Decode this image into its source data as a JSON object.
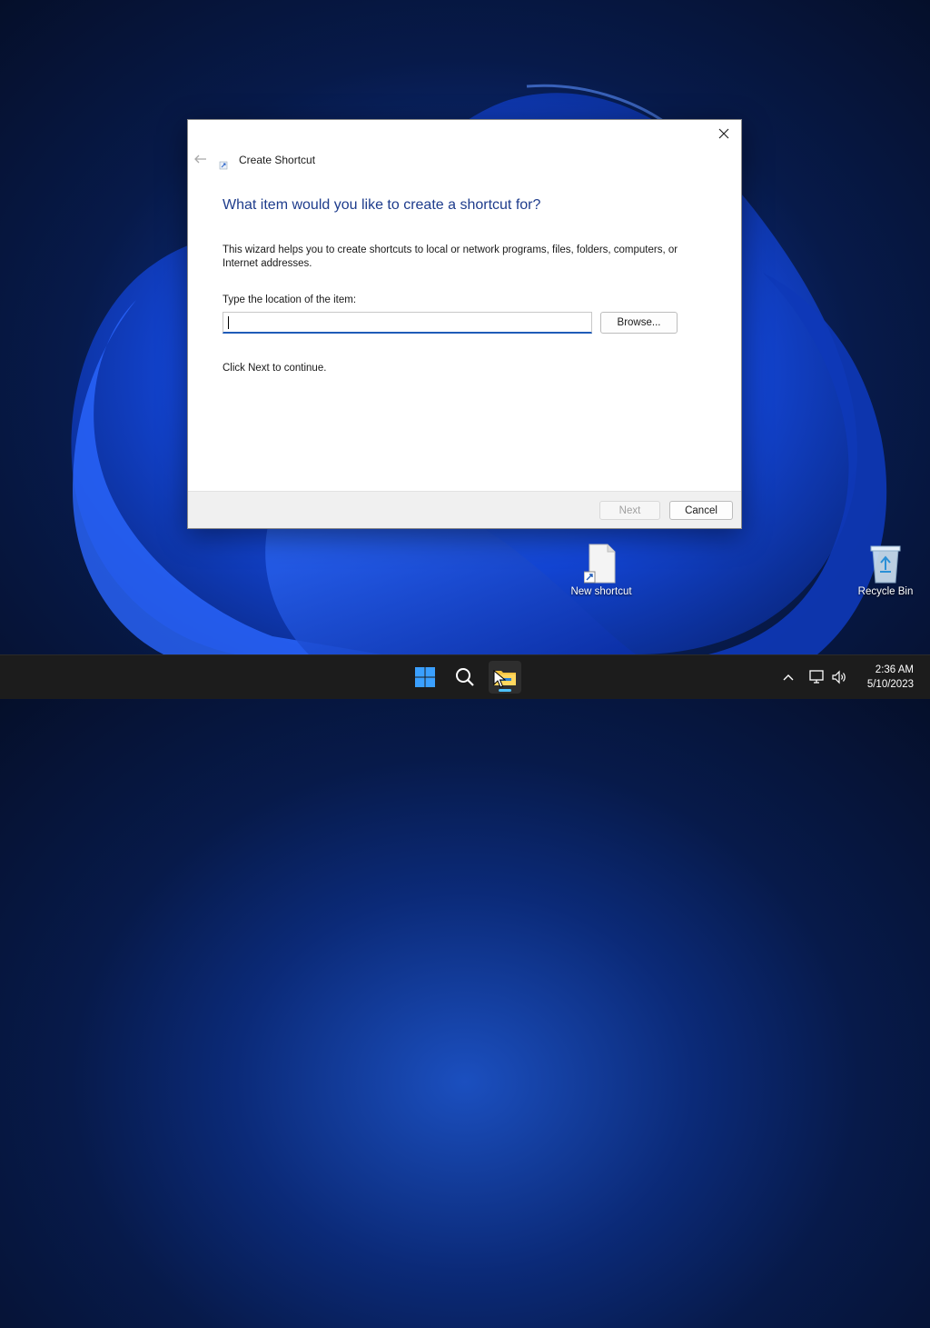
{
  "dialog": {
    "title": "Create Shortcut",
    "heading": "What item would you like to create a shortcut for?",
    "description": "This wizard helps you to create shortcuts to local or network programs, files, folders, computers, or Internet addresses.",
    "location_label": "Type the location of the item:",
    "location_value": "",
    "browse_label": "Browse...",
    "continue_text": "Click Next to continue.",
    "next_label": "Next",
    "cancel_label": "Cancel"
  },
  "desktop": {
    "icons": [
      {
        "label": "New shortcut",
        "icon": "shortcut-file-icon"
      },
      {
        "label": "Recycle Bin",
        "icon": "recycle-bin-icon"
      }
    ]
  },
  "taskbar": {
    "apps": [
      {
        "icon": "windows-start-icon"
      },
      {
        "icon": "search-icon"
      },
      {
        "icon": "file-explorer-icon",
        "active": true
      }
    ],
    "tray": {
      "time": "2:36 AM",
      "date": "5/10/2023"
    }
  },
  "colors": {
    "accent": "#1f5bb8",
    "heading": "#1e3c8c",
    "taskbar": "#1c1c1c"
  }
}
